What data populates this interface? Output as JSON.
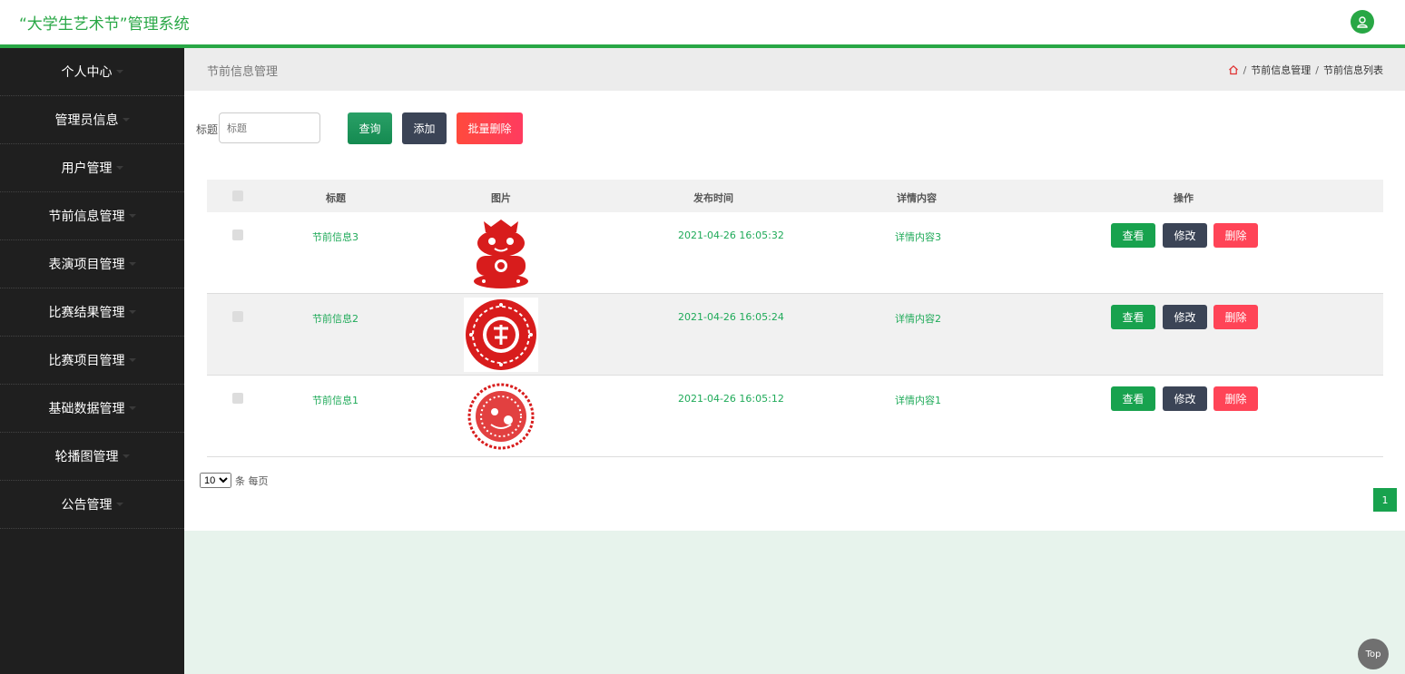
{
  "app": {
    "title": "“大学生艺术节”管理系统"
  },
  "sidebar": {
    "items": [
      {
        "label": "个人中心"
      },
      {
        "label": "管理员信息"
      },
      {
        "label": "用户管理"
      },
      {
        "label": "节前信息管理"
      },
      {
        "label": "表演项目管理"
      },
      {
        "label": "比赛结果管理"
      },
      {
        "label": "比赛项目管理"
      },
      {
        "label": "基础数据管理"
      },
      {
        "label": "轮播图管理"
      },
      {
        "label": "公告管理"
      }
    ]
  },
  "header": {
    "page_title": "节前信息管理",
    "breadcrumb": [
      "节前信息管理",
      "节前信息列表"
    ],
    "separator": "/"
  },
  "search": {
    "label": "标题",
    "placeholder": "标题",
    "query_button": "查询",
    "add_button": "添加",
    "batch_delete_button": "批量删除"
  },
  "table": {
    "columns": [
      "标题",
      "图片",
      "发布时间",
      "详情内容",
      "操作"
    ],
    "rows": [
      {
        "title": "节前信息3",
        "time": "2021-04-26 16:05:32",
        "detail": "详情内容3"
      },
      {
        "title": "节前信息2",
        "time": "2021-04-26 16:05:24",
        "detail": "详情内容2"
      },
      {
        "title": "节前信息1",
        "time": "2021-04-26 16:05:12",
        "detail": "详情内容1"
      }
    ],
    "actions": {
      "view": "查看",
      "edit": "修改",
      "delete": "删除"
    }
  },
  "pager": {
    "page_size": "10",
    "page_size_suffix": "条 每页",
    "current_page": "1"
  },
  "back_to_top": "Top",
  "colors": {
    "accent": "#28a745",
    "sidebar_bg": "#1f1f1f",
    "danger": "#ff4457",
    "dark_button": "#3b4456"
  }
}
